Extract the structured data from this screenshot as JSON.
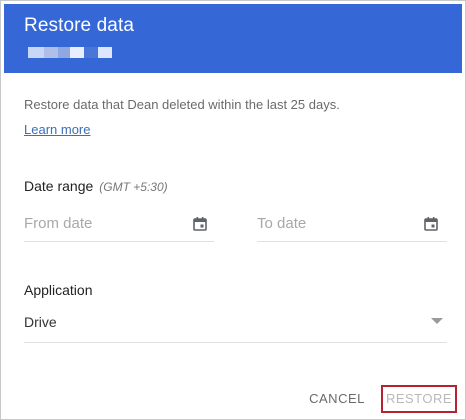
{
  "dialog": {
    "title": "Restore data",
    "masked_user_icon": "redacted-user-name",
    "description": "Restore data that Dean deleted within the last 25 days.",
    "learn_more": "Learn more",
    "date_range": {
      "label": "Date range",
      "timezone": "(GMT +5:30)",
      "from_placeholder": "From date",
      "to_placeholder": "To date",
      "icon": "calendar-icon"
    },
    "application": {
      "label": "Application",
      "selected": "Drive",
      "icon": "dropdown-caret-icon"
    },
    "buttons": {
      "cancel": "CANCEL",
      "restore": "RESTORE"
    }
  },
  "colors": {
    "header": "#3567d6",
    "link": "#3b6fb6",
    "highlight_border": "#b8222e"
  }
}
